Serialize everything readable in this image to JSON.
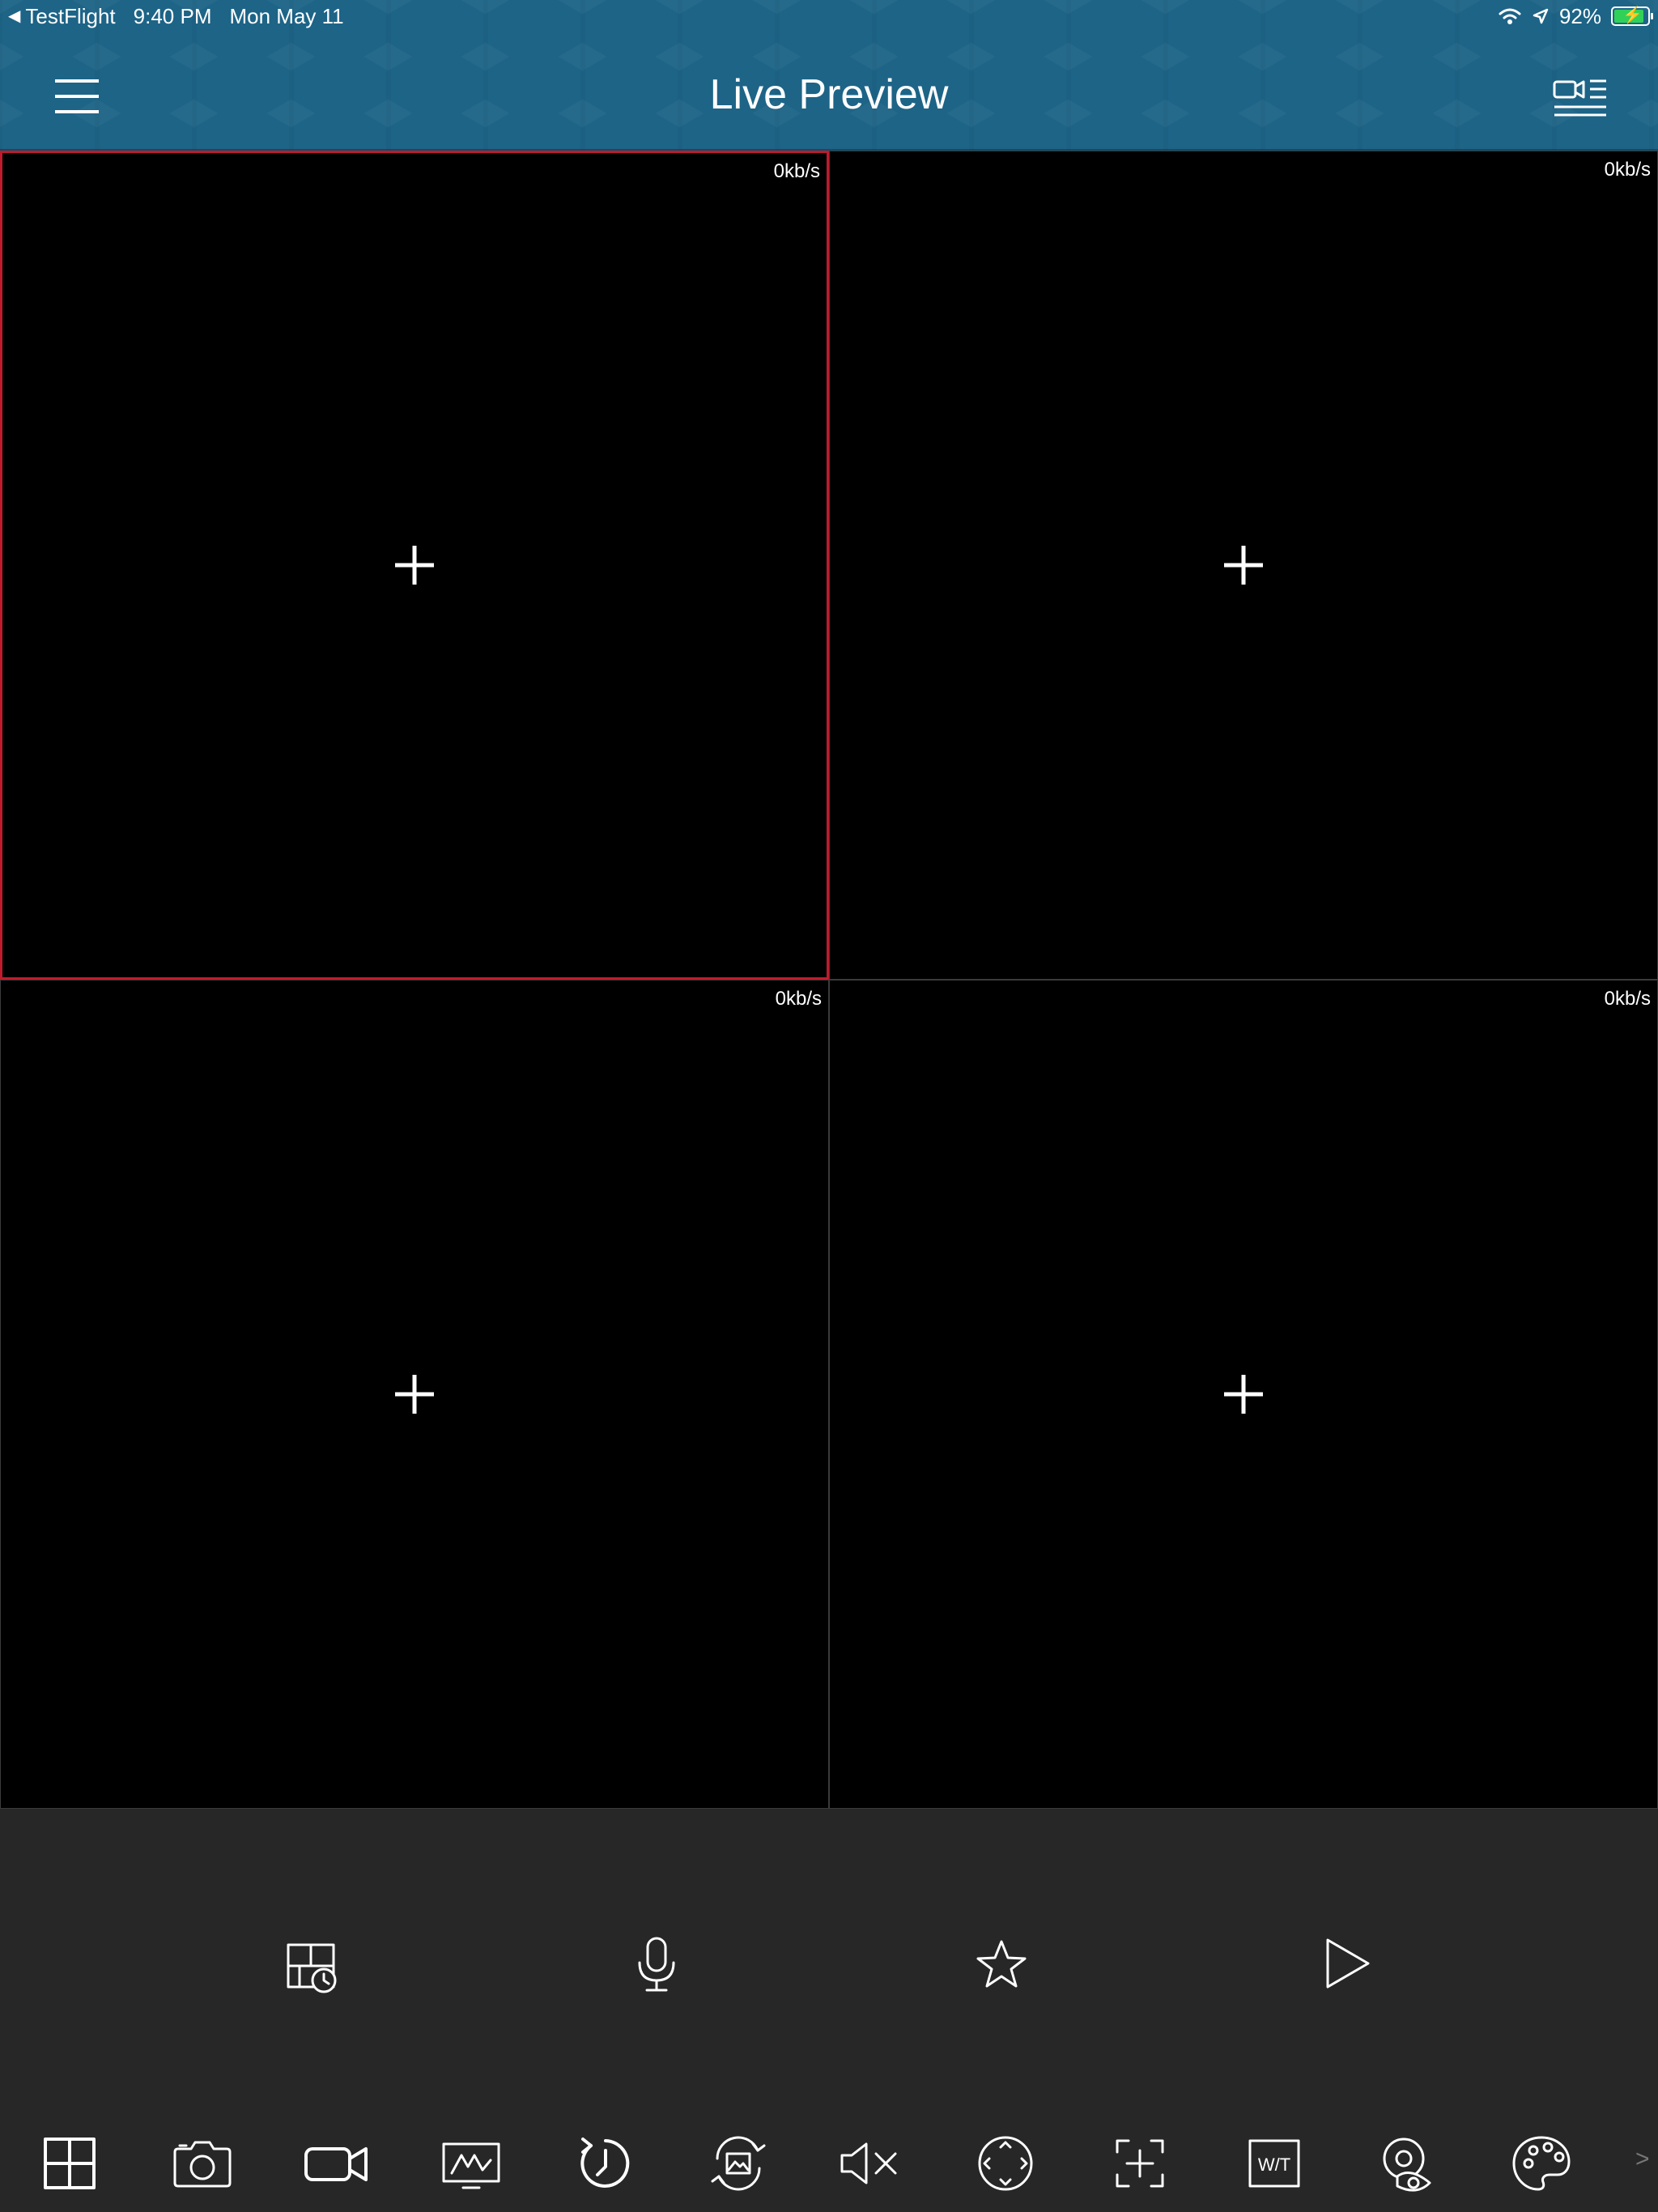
{
  "status_bar": {
    "back_app": "TestFlight",
    "time": "9:40 PM",
    "date": "Mon May 11",
    "battery": "92%"
  },
  "header": {
    "title": "Live Preview",
    "menu_icon": "hamburger-icon",
    "device_list_icon": "device-list-icon"
  },
  "grid": {
    "cells": [
      {
        "rate": "0kb/s",
        "selected": true
      },
      {
        "rate": "0kb/s",
        "selected": false
      },
      {
        "rate": "0kb/s",
        "selected": false
      },
      {
        "rate": "0kb/s",
        "selected": false
      }
    ]
  },
  "controls": [
    "playback-schedule-icon",
    "microphone-icon",
    "favorite-star-icon",
    "play-icon"
  ],
  "toolbar": {
    "icons": [
      "split-screen-icon",
      "snapshot-camera-icon",
      "record-video-icon",
      "stream-quality-icon",
      "history-playback-icon",
      "image-rotate-icon",
      "mute-icon",
      "ptz-direction-icon",
      "digital-zoom-icon",
      "wide-tele-icon",
      "fisheye-icon",
      "color-palette-icon"
    ],
    "wide_tele_label": "W/T",
    "more_glyph": ">"
  },
  "colors": {
    "header_bg": "#1d6487",
    "selected_border": "#c11a2b",
    "panel_bg": "#272727",
    "battery_fill": "#30d158"
  }
}
